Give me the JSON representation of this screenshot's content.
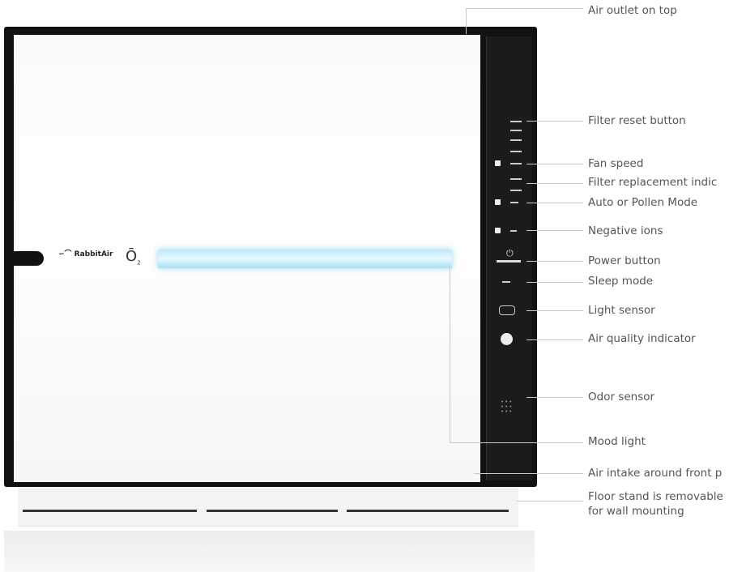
{
  "product": {
    "brand_logo": "RabbitAir",
    "ion_logo": "O2"
  },
  "callouts": [
    {
      "label": "Air outlet on top"
    },
    {
      "label": "Filter reset button"
    },
    {
      "label": "Fan speed"
    },
    {
      "label": "Filter replacement indic"
    },
    {
      "label": "Auto or Pollen Mode"
    },
    {
      "label": "Negative ions"
    },
    {
      "label": "Power button"
    },
    {
      "label": "Sleep mode"
    },
    {
      "label": "Light sensor"
    },
    {
      "label": "Air quality indicator"
    },
    {
      "label": "Odor sensor"
    },
    {
      "label": "Mood light"
    },
    {
      "label": "Air intake around front p"
    },
    {
      "label": "Floor stand is removable"
    },
    {
      "label": "for wall mounting"
    }
  ],
  "colors": {
    "frame": "#111111",
    "mood_light": "#bfe9f8",
    "leader_line": "#b9cfd3",
    "label_text": "#555555"
  }
}
